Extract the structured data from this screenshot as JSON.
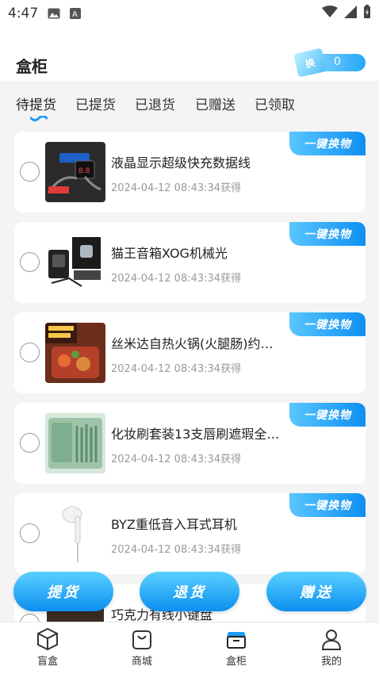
{
  "status_bar": {
    "time": "4:47"
  },
  "header": {
    "title": "盒柜",
    "exchange_icon_text": "换",
    "exchange_count": "0"
  },
  "tabs": [
    {
      "label": "待提货",
      "active": true
    },
    {
      "label": "已提货"
    },
    {
      "label": "已退货"
    },
    {
      "label": "已赠送"
    },
    {
      "label": "已领取"
    }
  ],
  "swap_label": "一键换物",
  "items": [
    {
      "name": "液晶显示超级快充数据线",
      "date": "2024-04-12 08:43:34获得"
    },
    {
      "name": "猫王音箱XOG机械光",
      "date": "2024-04-12 08:43:34获得"
    },
    {
      "name": "丝米达自热火锅(火腿肠)约…",
      "date": "2024-04-12 08:43:34获得"
    },
    {
      "name": "化妆刷套装13支唇刷遮瑕全…",
      "date": "2024-04-12 08:43:34获得"
    },
    {
      "name": "BYZ重低音入耳式耳机",
      "date": "2024-04-12 08:43:34获得"
    },
    {
      "name": "巧克力有线小键盘",
      "date": ""
    }
  ],
  "actions": {
    "pickup": "提货",
    "return": "退货",
    "gift": "赠送"
  },
  "bottom_nav": [
    {
      "label": "盲盒",
      "icon": "cube-icon"
    },
    {
      "label": "商城",
      "icon": "bag-icon"
    },
    {
      "label": "盒柜",
      "icon": "box-icon",
      "active": true
    },
    {
      "label": "我的",
      "icon": "person-icon"
    }
  ],
  "colors": {
    "accent": "#1a9cf5",
    "accent_light": "#5ad0ff"
  }
}
